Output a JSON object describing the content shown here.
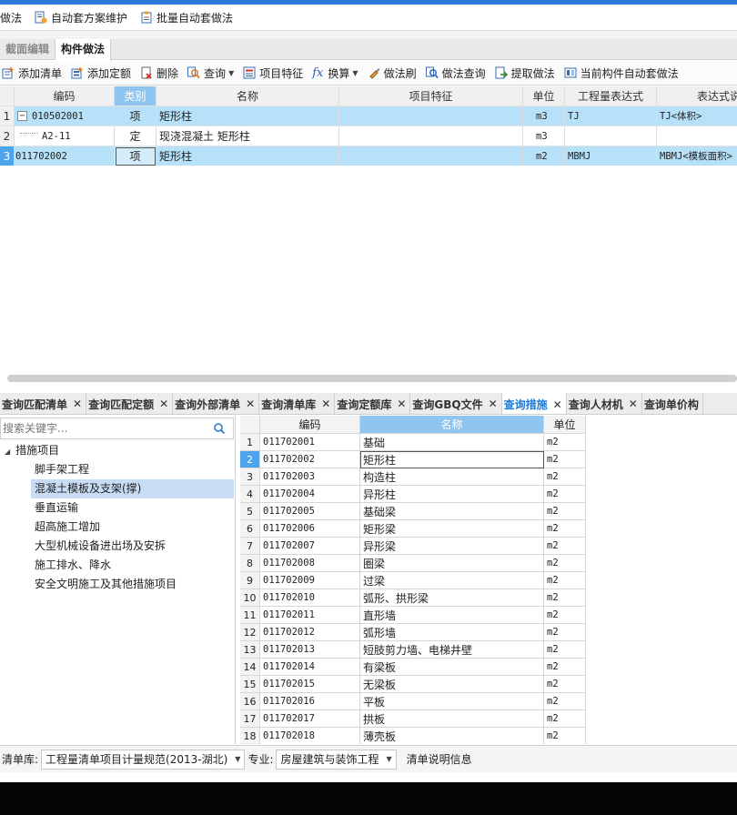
{
  "toolbar": {
    "items": [
      {
        "label": "做法",
        "icon": "none"
      },
      {
        "label": "自动套方案维护",
        "icon": "doc-gear-icon"
      },
      {
        "label": "批量自动套做法",
        "icon": "clipboard-icon"
      }
    ]
  },
  "editor_tabs": [
    {
      "label": "截面编辑",
      "active": false
    },
    {
      "label": "构件做法",
      "active": true
    }
  ],
  "method_toolbar": {
    "add_list": "添加清单",
    "add_quota": "添加定额",
    "delete": "删除",
    "query": "查询",
    "item_feature": "项目特征",
    "convert": "换算",
    "method_brush": "做法刷",
    "method_query": "做法查询",
    "extract_method": "提取做法",
    "auto_apply_current": "当前构件自动套做法"
  },
  "method_grid": {
    "columns": [
      "编码",
      "类别",
      "名称",
      "项目特征",
      "单位",
      "工程量表达式",
      "表达式说"
    ],
    "rows": [
      {
        "num": "1",
        "code": "010502001",
        "type": "项",
        "name": "矩形柱",
        "feature": "",
        "unit": "m3",
        "expr": "TJ",
        "expr_desc": "TJ<体积>",
        "expander": "−",
        "highlight": true
      },
      {
        "num": "2",
        "code": "A2-11",
        "type": "定",
        "name": "现浇混凝土 矩形柱",
        "feature": "",
        "unit": "m3",
        "expr": "",
        "expr_desc": "",
        "expander": "",
        "highlight": false
      },
      {
        "num": "3",
        "code": "011702002",
        "type": "项",
        "name": "矩形柱",
        "feature": "",
        "unit": "m2",
        "expr": "MBMJ",
        "expr_desc": "MBMJ<模板面积>",
        "expander": "",
        "highlight": true
      }
    ]
  },
  "query_tabs": [
    {
      "label": "查询匹配清单",
      "active": false
    },
    {
      "label": "查询匹配定额",
      "active": false
    },
    {
      "label": "查询外部清单",
      "active": false
    },
    {
      "label": "查询清单库",
      "active": false
    },
    {
      "label": "查询定额库",
      "active": false
    },
    {
      "label": "查询GBQ文件",
      "active": false
    },
    {
      "label": "查询措施",
      "active": true
    },
    {
      "label": "查询人材机",
      "active": false
    },
    {
      "label": "查询单价构",
      "active": false
    }
  ],
  "search": {
    "placeholder": "搜索关键字..."
  },
  "tree": {
    "root": "措施项目",
    "children": [
      "脚手架工程",
      "混凝土模板及支架(撑)",
      "垂直运输",
      "超高施工增加",
      "大型机械设备进出场及安拆",
      "施工排水、降水",
      "安全文明施工及其他措施项目"
    ],
    "selected_index": 1
  },
  "measure_grid": {
    "columns": [
      "编码",
      "名称",
      "单位"
    ],
    "selected_row": 2,
    "rows": [
      {
        "num": "1",
        "code": "011702001",
        "name": "基础",
        "unit": "m2"
      },
      {
        "num": "2",
        "code": "011702002",
        "name": "矩形柱",
        "unit": "m2"
      },
      {
        "num": "3",
        "code": "011702003",
        "name": "构造柱",
        "unit": "m2"
      },
      {
        "num": "4",
        "code": "011702004",
        "name": "异形柱",
        "unit": "m2"
      },
      {
        "num": "5",
        "code": "011702005",
        "name": "基础梁",
        "unit": "m2"
      },
      {
        "num": "6",
        "code": "011702006",
        "name": "矩形梁",
        "unit": "m2"
      },
      {
        "num": "7",
        "code": "011702007",
        "name": "异形梁",
        "unit": "m2"
      },
      {
        "num": "8",
        "code": "011702008",
        "name": "圈梁",
        "unit": "m2"
      },
      {
        "num": "9",
        "code": "011702009",
        "name": "过梁",
        "unit": "m2"
      },
      {
        "num": "10",
        "code": "011702010",
        "name": "弧形、拱形梁",
        "unit": "m2"
      },
      {
        "num": "11",
        "code": "011702011",
        "name": "直形墙",
        "unit": "m2"
      },
      {
        "num": "12",
        "code": "011702012",
        "name": "弧形墙",
        "unit": "m2"
      },
      {
        "num": "13",
        "code": "011702013",
        "name": "短肢剪力墙、电梯井壁",
        "unit": "m2"
      },
      {
        "num": "14",
        "code": "011702014",
        "name": "有梁板",
        "unit": "m2"
      },
      {
        "num": "15",
        "code": "011702015",
        "name": "无梁板",
        "unit": "m2"
      },
      {
        "num": "16",
        "code": "011702016",
        "name": "平板",
        "unit": "m2"
      },
      {
        "num": "17",
        "code": "011702017",
        "name": "拱板",
        "unit": "m2"
      },
      {
        "num": "18",
        "code": "011702018",
        "name": "薄壳板",
        "unit": "m2"
      }
    ]
  },
  "status": {
    "library_label": "清单库:",
    "library_value": "工程量清单项目计量规范(2013-湖北)",
    "major_label": "专业:",
    "major_value": "房屋建筑与装饰工程",
    "info": "清单说明信息"
  },
  "colors": {
    "accent": "#2b79d7",
    "row_highlight": "#b7e1f9",
    "header_highlight": "#8fc5ef",
    "active_tab_text": "#1e7ad6"
  }
}
